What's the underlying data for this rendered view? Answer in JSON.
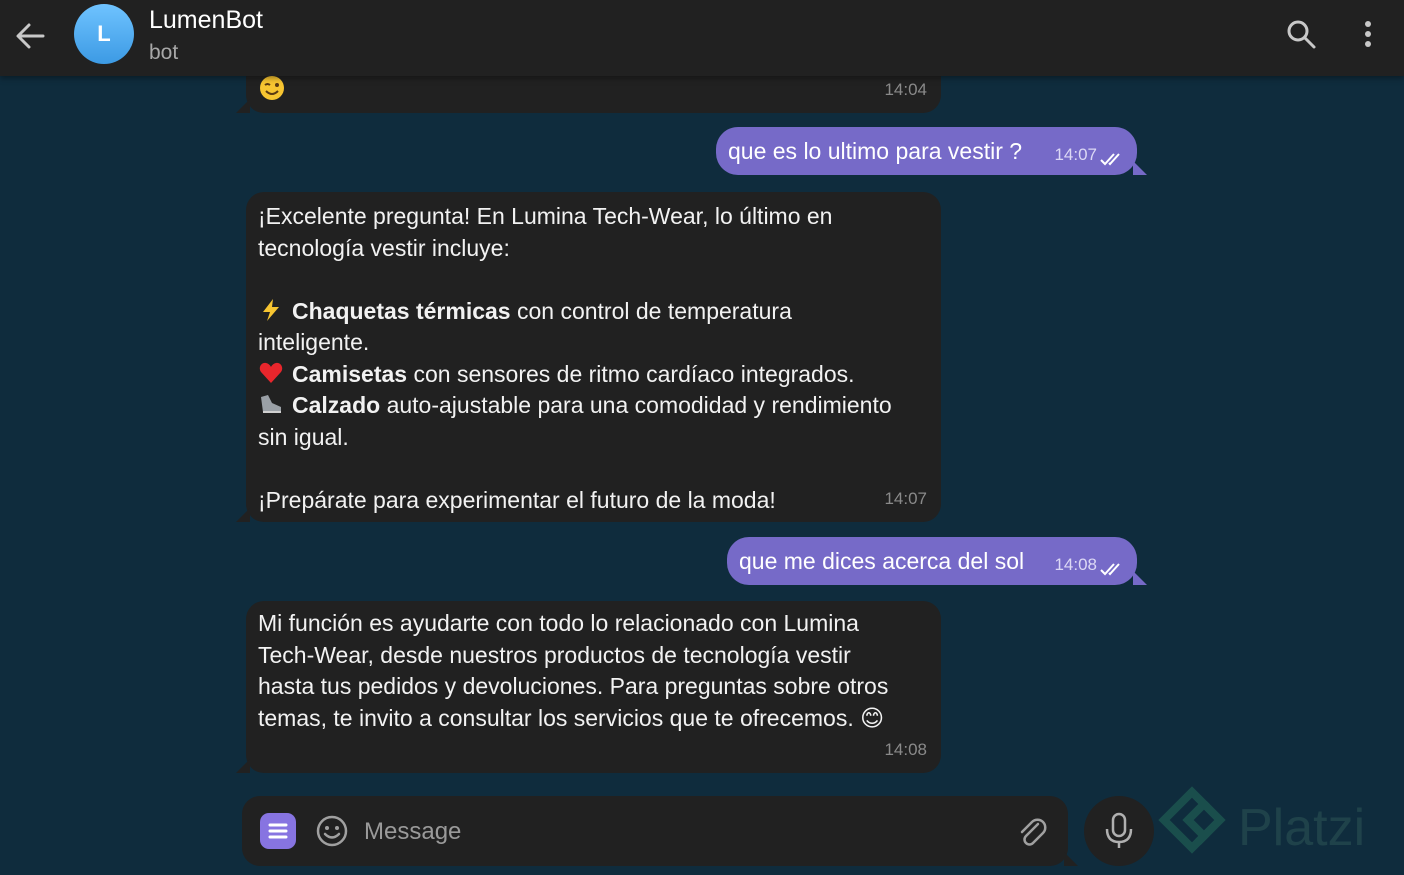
{
  "header": {
    "title": "LumenBot",
    "subtitle": "bot",
    "avatar_letter": "L",
    "avatar_color": "#54a9eb",
    "icons": [
      "arrow-left-icon",
      "search-icon",
      "more-vert-icon"
    ]
  },
  "colors": {
    "background": "#0f2c3d",
    "incoming_bubble": "#212121",
    "outgoing_bubble": "#766ac8",
    "accent": "#8774e1"
  },
  "messages": [
    {
      "direction": "in",
      "emoji": "wink",
      "time": "14:04"
    },
    {
      "direction": "out",
      "text": "que es lo ultimo para vestir ?",
      "time": "14:07",
      "status": "read"
    },
    {
      "direction": "in",
      "time": "14:07",
      "lines": [
        "¡Excelente pregunta! En Lumina Tech-Wear, lo último en",
        "tecnología vestir incluye:",
        "",
        {
          "emoji": "high-voltage",
          "bold": "Chaquetas térmicas",
          "rest": " con control de temperatura"
        },
        "inteligente.",
        {
          "emoji": "red-heart",
          "bold": "Camisetas",
          "rest": " con sensores de ritmo cardíaco integrados."
        },
        {
          "emoji": "running-shoe",
          "bold": "Calzado",
          "rest": " auto-ajustable para una comodidad y rendimiento"
        },
        "sin igual.",
        "",
        "¡Prepárate para experimentar el futuro de la moda!"
      ]
    },
    {
      "direction": "out",
      "text": "que me dices acerca del sol",
      "time": "14:08",
      "status": "read"
    },
    {
      "direction": "in",
      "time": "14:08",
      "lines": [
        "Mi función es ayudarte con todo lo relacionado con Lumina",
        "Tech-Wear, desde nuestros productos de tecnología vestir",
        "hasta tus pedidos y devoluciones. Para preguntas sobre otros",
        "temas, te invito a consultar los servicios que te ofrecemos. 😊"
      ]
    }
  ],
  "composer": {
    "placeholder": "Message",
    "icons": [
      "menu-icon",
      "emoji-icon",
      "attach-icon",
      "microphone-icon"
    ]
  },
  "watermark": "Platzi"
}
